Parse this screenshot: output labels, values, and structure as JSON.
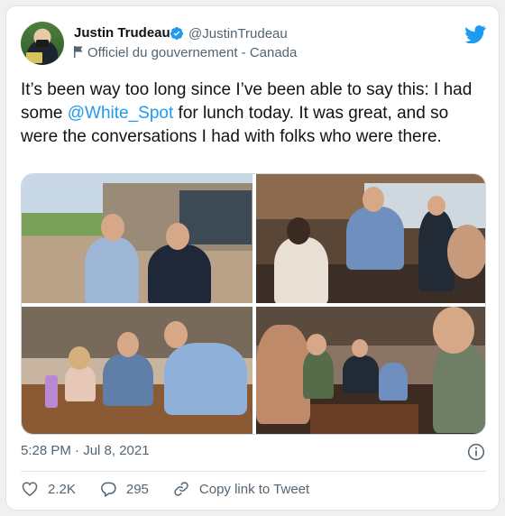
{
  "author": {
    "name": "Justin Trudeau",
    "handle": "@JustinTrudeau",
    "label": "Officiel du gouvernement - Canada"
  },
  "tweet": {
    "text_before": "It’s been way too long since I’ve been able to say this: I had some ",
    "mention": "@White_Spot",
    "text_after": " for lunch today. It was great, and so were the conversations I had with folks who were there."
  },
  "meta": {
    "timestamp": "5:28 PM · Jul 8, 2021"
  },
  "actions": {
    "likes": "2.2K",
    "replies": "295",
    "copy_link": "Copy link to Tweet"
  },
  "colors": {
    "accent": "#1d9bf0",
    "muted": "#536471"
  },
  "icons": [
    "verified-badge-icon",
    "government-flag-icon",
    "twitter-bird-icon",
    "info-icon",
    "heart-icon",
    "reply-icon",
    "link-icon"
  ]
}
